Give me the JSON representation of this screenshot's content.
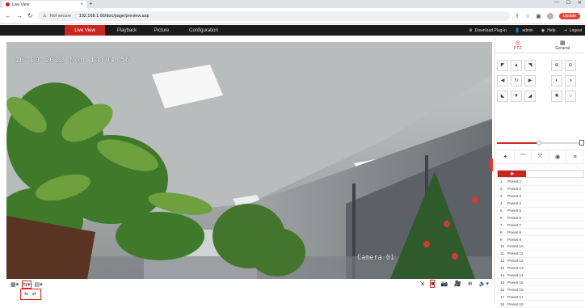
{
  "browser": {
    "tab_title": "Live View",
    "tab_close": "×",
    "new_tab": "+",
    "window_controls": [
      "—",
      "☐",
      "✕"
    ],
    "security_label": "Not secure",
    "url": "192.168.1.66/doc/page/preview.asp",
    "update_label": "Update"
  },
  "app": {
    "nav": [
      "Live View",
      "Playback",
      "Picture",
      "Configuration"
    ],
    "header_right": [
      {
        "icon": "plugin-icon",
        "label": "Download Plug-in"
      },
      {
        "icon": "user-icon",
        "label": "admin"
      },
      {
        "icon": "help-icon",
        "label": "Help"
      },
      {
        "icon": "logout-icon",
        "label": "Logout"
      }
    ]
  },
  "video": {
    "timestamp": "10-10-2022 Mon 14:04:56",
    "camera_name": "Camera 01"
  },
  "panel": {
    "tabs": [
      "PTZ",
      "General"
    ]
  },
  "presets": [
    {
      "num": "1",
      "name": "Preset 1"
    },
    {
      "num": "2",
      "name": "Preset 2"
    },
    {
      "num": "3",
      "name": "Preset 3"
    },
    {
      "num": "4",
      "name": "Preset 4"
    },
    {
      "num": "5",
      "name": "Preset 5"
    },
    {
      "num": "6",
      "name": "Preset 6"
    },
    {
      "num": "7",
      "name": "Preset 7"
    },
    {
      "num": "8",
      "name": "Preset 8"
    },
    {
      "num": "9",
      "name": "Preset 9"
    },
    {
      "num": "10",
      "name": "Preset 10"
    },
    {
      "num": "11",
      "name": "Preset 11"
    },
    {
      "num": "12",
      "name": "Preset 12"
    },
    {
      "num": "13",
      "name": "Preset 13"
    },
    {
      "num": "14",
      "name": "Preset 14"
    },
    {
      "num": "15",
      "name": "Preset 15"
    },
    {
      "num": "16",
      "name": "Preset 16"
    },
    {
      "num": "17",
      "name": "Preset 17"
    },
    {
      "num": "18",
      "name": "Preset 18"
    }
  ],
  "colors": {
    "accent": "#c8261f",
    "header_bg": "#1b1b1b"
  }
}
